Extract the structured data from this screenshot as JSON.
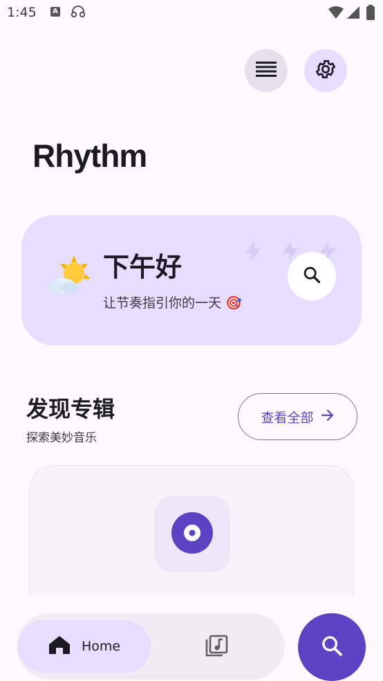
{
  "status_bar": {
    "time": "1:45",
    "icons": [
      "a-icon",
      "headset-icon",
      "wifi-icon",
      "signal-icon",
      "battery-icon"
    ]
  },
  "header": {
    "app_title": "Rhythm",
    "menu_icon": "menu-icon",
    "settings_icon": "gear-icon"
  },
  "greeting": {
    "emoji": "sun-behind-cloud-icon",
    "title": "下午好",
    "subtitle": "让节奏指引你的一天 🎯",
    "search_icon": "search-icon"
  },
  "albums_section": {
    "title": "发现专辑",
    "subtitle": "探索美妙音乐",
    "view_all_label": "查看全部",
    "view_all_icon": "arrow-right-icon"
  },
  "bottom_nav": {
    "home_label": "Home",
    "home_icon": "home-icon",
    "library_icon": "library-music-icon",
    "fab_icon": "search-icon"
  },
  "colors": {
    "accent": "#5b43c4",
    "card_bg": "#e6ddff",
    "background": "#fdf9ff"
  }
}
